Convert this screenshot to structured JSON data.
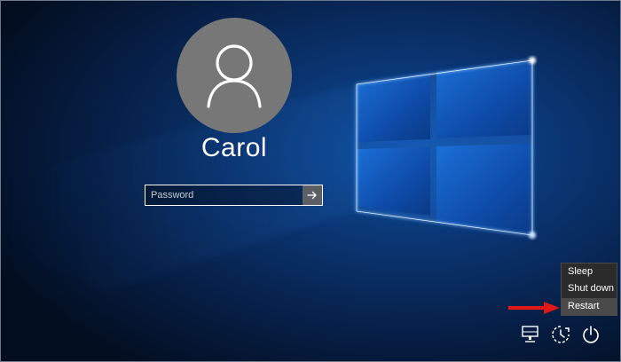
{
  "user": {
    "name": "Carol",
    "avatar_icon": "user-silhouette-icon"
  },
  "password": {
    "placeholder": "Password",
    "value": "",
    "submit_icon": "arrow-right-icon"
  },
  "power_menu": {
    "items": [
      {
        "label": "Sleep"
      },
      {
        "label": "Shut down"
      },
      {
        "label": "Restart"
      }
    ],
    "highlighted": "Restart"
  },
  "corner_icons": [
    {
      "name": "network-icon"
    },
    {
      "name": "ease-of-access-icon"
    },
    {
      "name": "power-icon"
    }
  ],
  "colors": {
    "background": "#03152c",
    "logo_glow": "#3d8bff",
    "avatar_bg": "#777777",
    "menu_bg": "#2b2b2b",
    "menu_selected": "#4a4a4a",
    "pointer_arrow": "#e01818"
  }
}
